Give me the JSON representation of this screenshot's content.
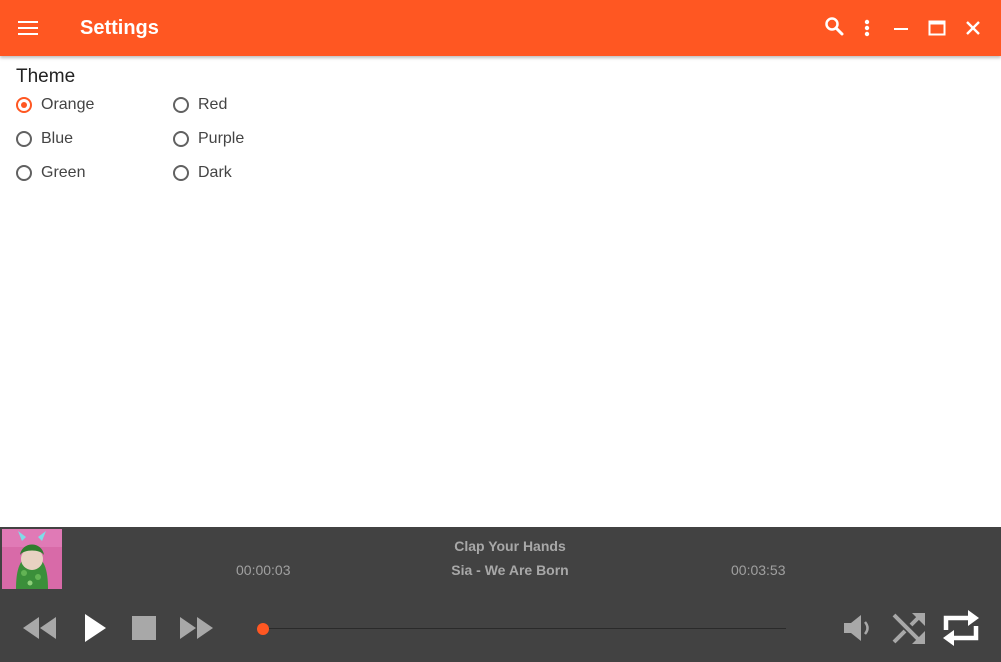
{
  "window": {
    "title": "Settings"
  },
  "appbar": {
    "menu_icon": "hamburger-menu-icon",
    "search_icon": "search-icon",
    "more_icon": "more-vert-icon",
    "minimize_icon": "minimize-icon",
    "maximize_icon": "maximize-icon",
    "close_icon": "close-icon"
  },
  "theme": {
    "heading": "Theme",
    "selected": "Orange",
    "options": [
      "Orange",
      "Red",
      "Blue",
      "Purple",
      "Green",
      "Dark"
    ]
  },
  "player": {
    "track_title": "Clap Your Hands",
    "track_artist": "Sia - We Are Born",
    "elapsed": "00:00:03",
    "duration": "00:03:53",
    "progress": 0.0,
    "controls": [
      "rewind-icon",
      "play-icon",
      "stop-icon",
      "fast-forward-icon"
    ],
    "right_controls": [
      "volume-icon",
      "shuffle-icon",
      "repeat-icon"
    ]
  },
  "colors": {
    "accent": "#ff5722",
    "player_bg": "#424242",
    "text_muted": "#a8a8a8"
  }
}
